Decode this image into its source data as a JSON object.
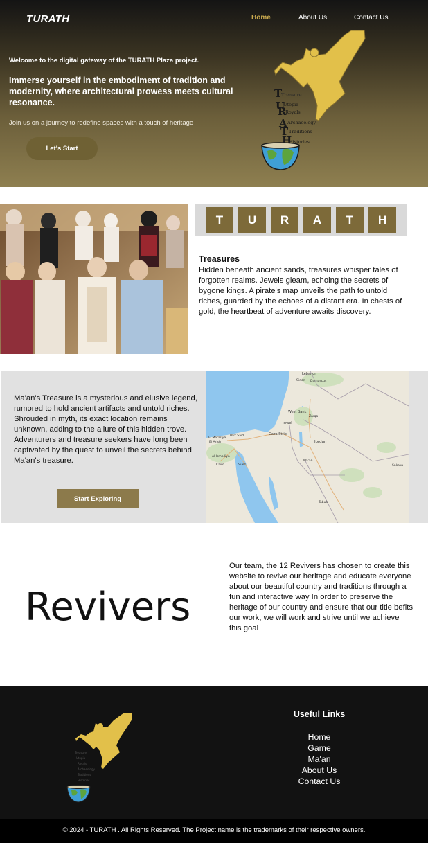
{
  "header": {
    "brand": "TURATH",
    "nav": {
      "home": "Home",
      "about": "About Us",
      "contact": "Contact Us"
    }
  },
  "hero": {
    "welcome": "Welcome to the digital gateway of the TURATH Plaza project.",
    "immerse": "Immerse yourself in the embodiment of tradition and modernity, where architectural prowess meets cultural resonance.",
    "join": "Join us on a journey to redefine spaces with a touch of heritage",
    "cta": "Let's Start",
    "logo_words": [
      "Treasure",
      "Utopia",
      "Royals",
      "Archaeology",
      "Traditions",
      "Histories"
    ],
    "logo_initials": [
      "T",
      "U",
      "R",
      "A",
      "T",
      "H"
    ]
  },
  "turath_letters": [
    "T",
    "U",
    "R",
    "A",
    "T",
    "H"
  ],
  "treasures": {
    "title": "Treasures",
    "text": "Hidden beneath ancient sands, treasures whisper tales of forgotten realms. Jewels gleam, echoing the secrets of bygone kings. A pirate's map unveils the path to untold riches, guarded by the echoes of a distant era. In chests of gold, the heartbeat of adventure awaits discovery."
  },
  "maan": {
    "text": "Ma'an's Treasure  is a mysterious and elusive legend, rumored to hold ancient artifacts and untold riches. Shrouded in myth, its exact location remains unknown, adding to the allure of this hidden trove. Adventurers and treasure seekers have long been captivated by the quest to unveil the secrets behind Ma'an's treasure.",
    "cta": "Start Exploring",
    "map_labels": [
      "Lebanon",
      "Sidon",
      "Damascus",
      "West Bank",
      "Israel",
      "Zarqa",
      "Gaza Strip",
      "Port Said",
      "El Matariya",
      "El Arish",
      "Jordan",
      "Al Ismailiya",
      "Cairo",
      "Suez",
      "Ma'an",
      "Tabuk",
      "Sakaka"
    ]
  },
  "revivers": {
    "logo_text": "Revivers",
    "text": "Our team, the 12 Revivers has chosen to create this website to revive our heritage and educate everyone about our beautiful country and traditions through a fun and interactive way In order to preserve the heritage of our country and ensure that our title befits our work, we will work and strive until we achieve this goal"
  },
  "footer": {
    "useful_title": "Useful Links",
    "links": [
      "Home",
      "Game",
      "Ma'an",
      "About Us",
      "Contact Us"
    ],
    "copyright": "© 2024 -  TURATH . All Rights Reserved. The Project name is the trademarks of their respective owners."
  },
  "colors": {
    "accent_gold": "#c9a94f",
    "letter_tile": "#7d6a39",
    "button_brown": "#6f6134",
    "explore_button": "#8c7a4b",
    "logo_yellow": "#e2c04a",
    "footer_bg": "#121212",
    "section_gray": "#e1e1e1"
  }
}
